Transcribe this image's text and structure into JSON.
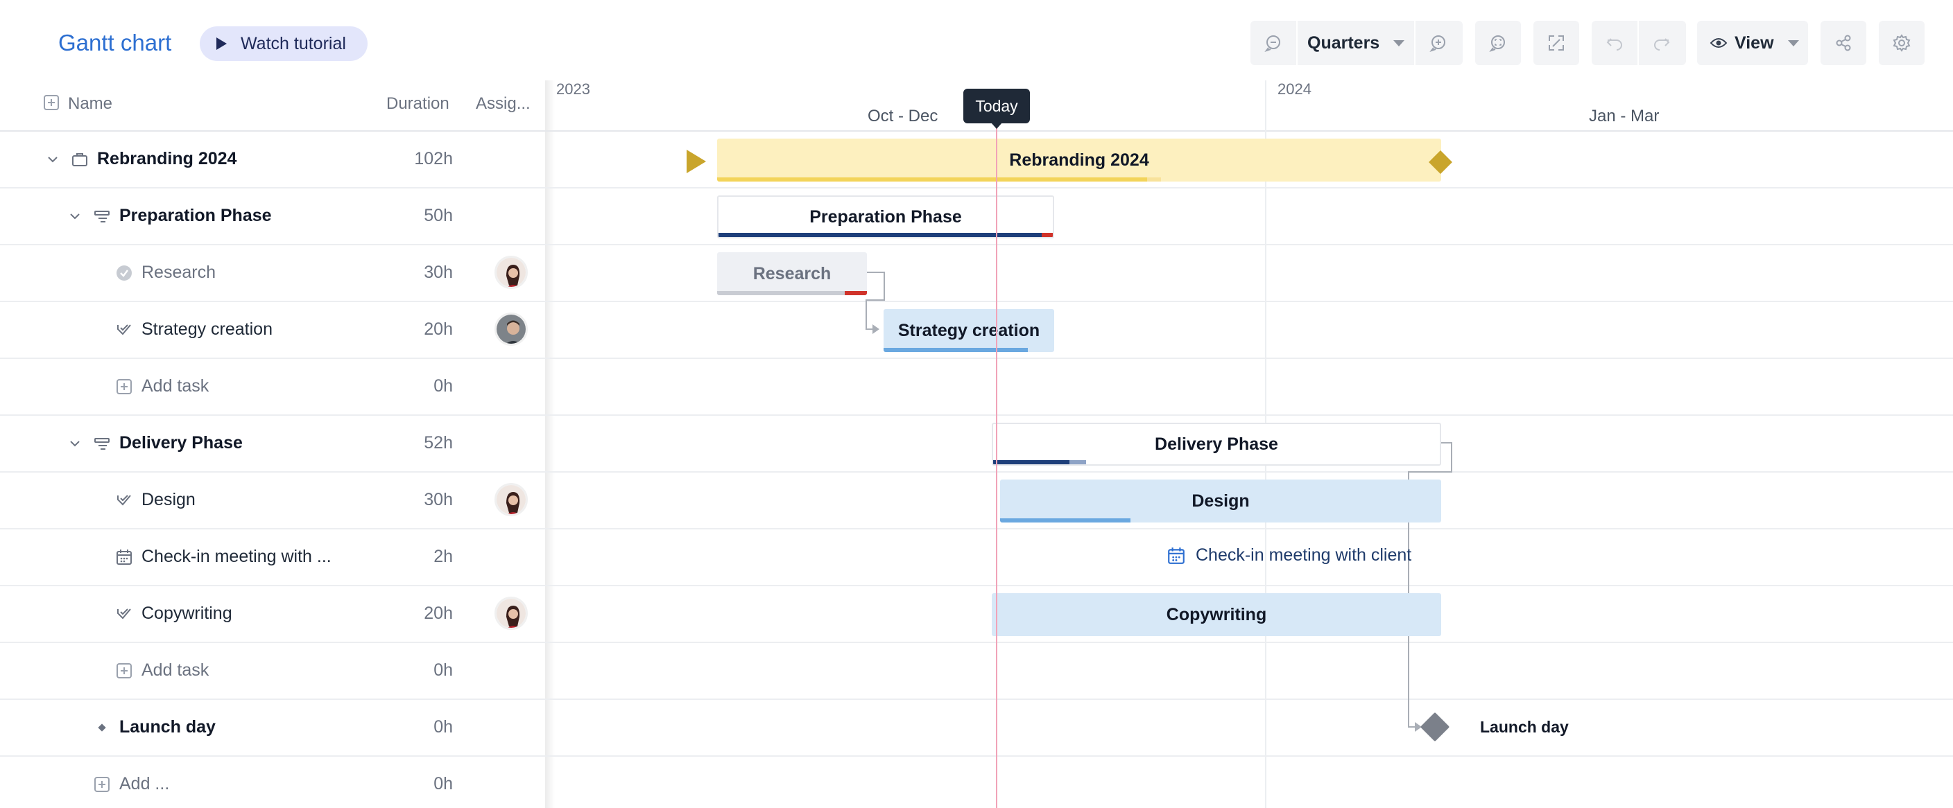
{
  "app": {
    "title": "Gantt chart",
    "tutorial_label": "Watch tutorial"
  },
  "toolbar": {
    "zoom_level": "Quarters",
    "view_label": "View"
  },
  "grid": {
    "columns": {
      "name": "Name",
      "duration": "Duration",
      "assignee": "Assig..."
    },
    "rows": [
      {
        "name": "Rebranding 2024",
        "duration": "102h",
        "type": "project"
      },
      {
        "name": "Preparation Phase",
        "duration": "50h",
        "type": "phase"
      },
      {
        "name": "Research",
        "duration": "30h",
        "type": "task-done"
      },
      {
        "name": "Strategy creation",
        "duration": "20h",
        "type": "task"
      },
      {
        "name": "Add task",
        "duration": "0h",
        "type": "add"
      },
      {
        "name": "Delivery Phase",
        "duration": "52h",
        "type": "phase"
      },
      {
        "name": "Design",
        "duration": "30h",
        "type": "task"
      },
      {
        "name": "Check-in meeting with ...",
        "duration": "2h",
        "type": "meeting"
      },
      {
        "name": "Copywriting",
        "duration": "20h",
        "type": "task"
      },
      {
        "name": "Add task",
        "duration": "0h",
        "type": "add"
      },
      {
        "name": "Launch day",
        "duration": "0h",
        "type": "milestone"
      },
      {
        "name": "Add ...",
        "duration": "0h",
        "type": "add"
      }
    ]
  },
  "timeline": {
    "years": [
      "2023",
      "2024"
    ],
    "quarters": [
      "Oct - Dec",
      "Jan - Mar"
    ],
    "today_label": "Today",
    "bars": {
      "project": "Rebranding 2024",
      "prep": "Preparation Phase",
      "research": "Research",
      "strategy": "Strategy creation",
      "delivery": "Delivery Phase",
      "design": "Design",
      "meeting": "Check-in meeting with client",
      "copy": "Copywriting",
      "launch": "Launch day"
    },
    "colors": {
      "project_bar": "#fdf0bf",
      "project_progress": "#f3d45a",
      "phase_progress": "#1e3f7a",
      "task_bar": "#d7e8f7",
      "task_progress": "#6aa8e0",
      "overdue": "#d0332a",
      "milestone": "#7b808a",
      "project_marker": "#c9a52c",
      "today_line": "#f1a3b8"
    }
  }
}
